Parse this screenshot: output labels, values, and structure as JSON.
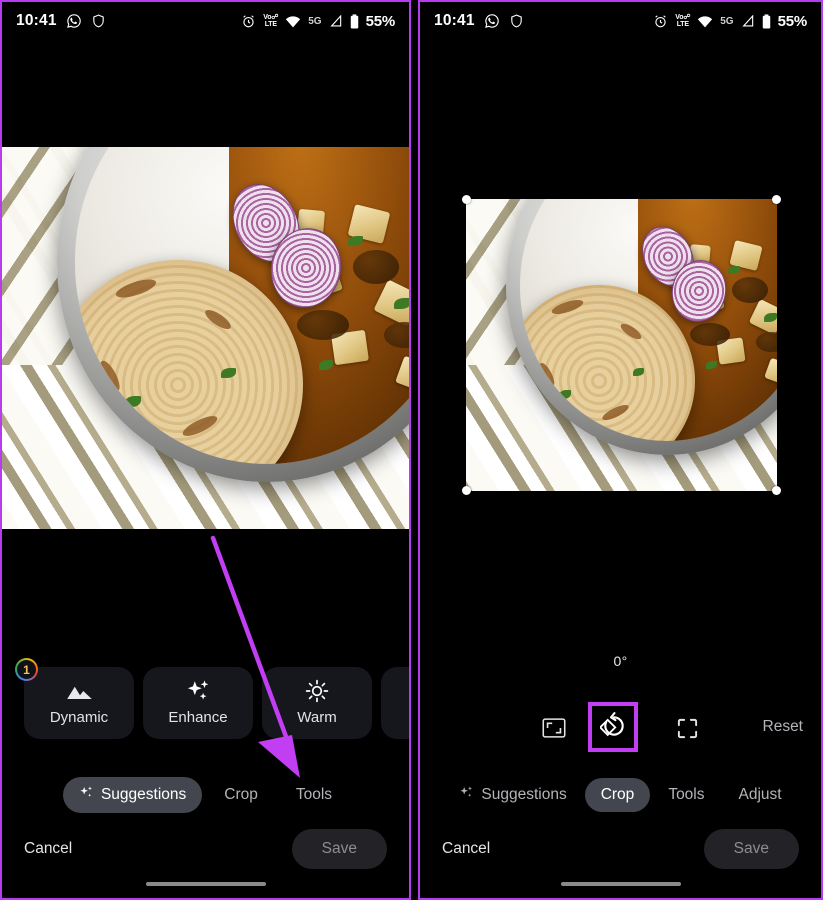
{
  "status_bar": {
    "time": "10:41",
    "left_icons": [
      "whatsapp-icon",
      "shield-icon"
    ],
    "alarm_icon": "alarm-icon",
    "volte_line1": "Vo☍",
    "volte_line2": "LTE",
    "wifi_icon": "wifi-icon",
    "network": "5G",
    "signal_icon": "signal-icon",
    "battery": "55%"
  },
  "left_panel": {
    "suggestions": [
      {
        "label": "Dynamic",
        "icon": "mountain-icon",
        "badge": "1"
      },
      {
        "label": "Enhance",
        "icon": "sparkle-icon",
        "badge": ""
      },
      {
        "label": "Warm",
        "icon": "sun-icon",
        "badge": ""
      }
    ],
    "tabs": [
      {
        "label": "Suggestions",
        "active": true,
        "icon": "sparkle-icon"
      },
      {
        "label": "Crop",
        "active": false,
        "icon": ""
      },
      {
        "label": "Tools",
        "active": false,
        "icon": ""
      }
    ],
    "cancel_label": "Cancel",
    "save_label": "Save"
  },
  "right_panel": {
    "rotation": {
      "angle_label": "0°",
      "ruler_ticks": 47,
      "center_tick_index": 23
    },
    "crop_tools": [
      {
        "name": "aspect-ratio-icon",
        "highlighted": false
      },
      {
        "name": "rotate-icon",
        "highlighted": true
      },
      {
        "name": "expand-icon",
        "highlighted": false
      }
    ],
    "reset_label": "Reset",
    "tabs": [
      {
        "label": "Suggestions",
        "active": false,
        "icon": "sparkle-icon"
      },
      {
        "label": "Crop",
        "active": true,
        "icon": ""
      },
      {
        "label": "Tools",
        "active": false,
        "icon": ""
      },
      {
        "label": "Adjust",
        "active": false,
        "icon": ""
      }
    ],
    "cancel_label": "Cancel",
    "save_label": "Save"
  },
  "annotation": {
    "arrow_color": "#c13ef2",
    "highlight_color": "#c13ef2",
    "panel_border_color": "#b73bf0"
  },
  "photo": {
    "description": "overhead-food-plate-paratha-paneer-curry-onion"
  }
}
